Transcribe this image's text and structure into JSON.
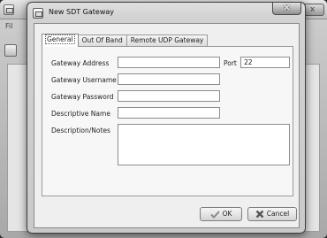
{
  "background_window": {
    "close_label": "x",
    "menu_label": "Fil"
  },
  "dialog": {
    "title": "New SDT Gateway",
    "close_label": "✕"
  },
  "tabs": [
    {
      "label": "General",
      "active": true
    },
    {
      "label": "Out Of Band",
      "active": false
    },
    {
      "label": "Remote UDP Gateway",
      "active": false
    }
  ],
  "form": {
    "gateway_address_label": "Gateway Address",
    "gateway_address_value": "",
    "port_label": "Port",
    "port_value": "22",
    "gateway_username_label": "Gateway Username",
    "gateway_username_value": "",
    "gateway_password_label": "Gateway Password",
    "gateway_password_value": "",
    "descriptive_name_label": "Descriptive Name",
    "descriptive_name_value": "",
    "description_notes_label": "Description/Notes",
    "description_notes_value": ""
  },
  "buttons": {
    "ok_label": "OK",
    "cancel_label": "Cancel"
  },
  "icons": {
    "ok": "checkmark-icon",
    "cancel": "x-cross-icon",
    "dialog": "window-app-icon"
  }
}
